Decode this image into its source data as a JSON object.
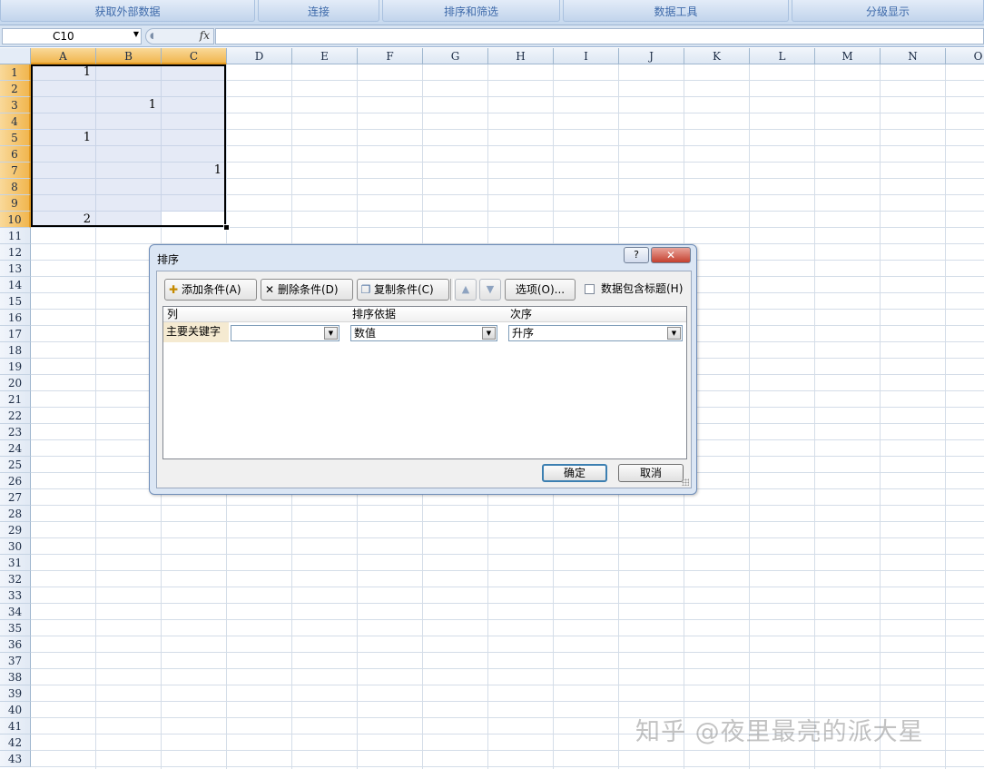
{
  "ribbon": {
    "groups": [
      "获取外部数据",
      "连接",
      "排序和筛选",
      "数据工具",
      "分级显示"
    ]
  },
  "formula_bar": {
    "name_box": "C10",
    "fx_label": "fx",
    "formula": ""
  },
  "sheet": {
    "columns": [
      "A",
      "B",
      "C",
      "D",
      "E",
      "F",
      "G",
      "H",
      "I",
      "J",
      "K",
      "L",
      "M",
      "N",
      "O"
    ],
    "rows": [
      "1",
      "2",
      "3",
      "4",
      "5",
      "6",
      "7",
      "8",
      "9",
      "10",
      "11",
      "12",
      "13",
      "14",
      "15",
      "16",
      "17",
      "18",
      "19",
      "20",
      "21",
      "22",
      "23",
      "24",
      "25",
      "26",
      "27",
      "28",
      "29",
      "30",
      "31",
      "32",
      "33",
      "34",
      "35",
      "36",
      "37",
      "38",
      "39",
      "40",
      "41",
      "42",
      "43"
    ],
    "cells": [
      {
        "ref": "A1",
        "value": "1"
      },
      {
        "ref": "B3",
        "value": "1"
      },
      {
        "ref": "A5",
        "value": "1"
      },
      {
        "ref": "C7",
        "value": "1"
      },
      {
        "ref": "A10",
        "value": "2"
      }
    ],
    "selection": "A1:C10",
    "active_cell": "C10"
  },
  "dialog": {
    "title": "排序",
    "help_label": "?",
    "close_label": "✕",
    "toolbar": {
      "add": "添加条件(A)",
      "delete": "删除条件(D)",
      "copy": "复制条件(C)",
      "up": "▲",
      "down": "▼",
      "options": "选项(O)...",
      "has_header_label": "数据包含标题(H)",
      "has_header_checked": false
    },
    "headers": {
      "column": "列",
      "sort_on": "排序依据",
      "order": "次序"
    },
    "row": {
      "label": "主要关键字",
      "column_value": "",
      "sort_on_value": "数值",
      "order_value": "升序"
    },
    "ok": "确定",
    "cancel": "取消"
  },
  "watermark": "知乎 @夜里最亮的派大星"
}
